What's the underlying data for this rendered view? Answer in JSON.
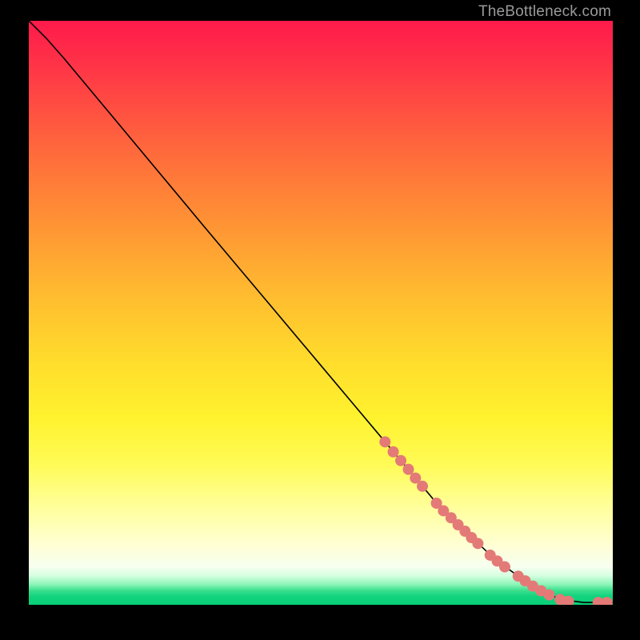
{
  "watermark": "TheBottleneck.com",
  "chart_data": {
    "type": "line",
    "title": "",
    "xlabel": "",
    "ylabel": "",
    "xlim": [
      0,
      100
    ],
    "ylim": [
      0,
      100
    ],
    "grid": false,
    "legend": false,
    "curve": [
      {
        "x": 0.0,
        "y": 100.0
      },
      {
        "x": 3.0,
        "y": 97.0
      },
      {
        "x": 6.0,
        "y": 93.6
      },
      {
        "x": 10.0,
        "y": 88.8
      },
      {
        "x": 14.0,
        "y": 84.0
      },
      {
        "x": 20.0,
        "y": 76.8
      },
      {
        "x": 30.0,
        "y": 64.8
      },
      {
        "x": 40.0,
        "y": 52.9
      },
      {
        "x": 50.0,
        "y": 41.0
      },
      {
        "x": 60.0,
        "y": 29.1
      },
      {
        "x": 70.0,
        "y": 17.2
      },
      {
        "x": 80.0,
        "y": 7.6
      },
      {
        "x": 86.0,
        "y": 3.4
      },
      {
        "x": 91.0,
        "y": 0.9
      },
      {
        "x": 95.0,
        "y": 0.4
      },
      {
        "x": 100.0,
        "y": 0.4
      }
    ],
    "markers": [
      {
        "x": 61.0,
        "y": 27.9
      },
      {
        "x": 62.4,
        "y": 26.2
      },
      {
        "x": 63.7,
        "y": 24.7
      },
      {
        "x": 65.0,
        "y": 23.2
      },
      {
        "x": 66.2,
        "y": 21.7
      },
      {
        "x": 67.4,
        "y": 20.3
      },
      {
        "x": 69.8,
        "y": 17.4
      },
      {
        "x": 71.0,
        "y": 16.1
      },
      {
        "x": 72.3,
        "y": 14.9
      },
      {
        "x": 73.5,
        "y": 13.7
      },
      {
        "x": 74.7,
        "y": 12.6
      },
      {
        "x": 75.8,
        "y": 11.5
      },
      {
        "x": 76.9,
        "y": 10.5
      },
      {
        "x": 79.0,
        "y": 8.5
      },
      {
        "x": 80.2,
        "y": 7.5
      },
      {
        "x": 81.5,
        "y": 6.5
      },
      {
        "x": 83.8,
        "y": 4.9
      },
      {
        "x": 85.0,
        "y": 4.1
      },
      {
        "x": 86.3,
        "y": 3.2
      },
      {
        "x": 87.7,
        "y": 2.4
      },
      {
        "x": 89.1,
        "y": 1.7
      },
      {
        "x": 91.0,
        "y": 0.9
      },
      {
        "x": 92.4,
        "y": 0.6
      },
      {
        "x": 97.5,
        "y": 0.4
      },
      {
        "x": 99.0,
        "y": 0.4
      }
    ],
    "marker_color": "#e47a77",
    "marker_radius": 7
  }
}
